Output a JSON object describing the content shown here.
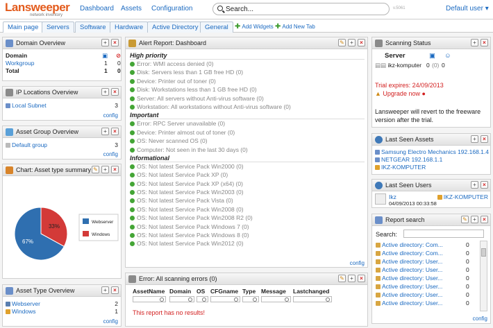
{
  "topbar": {
    "logo_main": "Lansweeper",
    "logo_sub": "network inventory",
    "nav": [
      "Dashboard",
      "Assets",
      "Configuration"
    ],
    "search_placeholder": "Search...",
    "version": "v.5061",
    "user_menu": "Default user ▾"
  },
  "tabs": [
    "Main page",
    "Servers",
    "Software",
    "Hardware",
    "Active Directory",
    "General"
  ],
  "tab_links": [
    "Add Widgets",
    "Add New Tab"
  ],
  "domain_overview": {
    "title": "Domain Overview",
    "header": "Domain",
    "rows": [
      {
        "name": "Workgroup",
        "a": "1",
        "b": "0"
      }
    ],
    "total": {
      "name": "Total",
      "a": "1",
      "b": "0"
    }
  },
  "ip_locations": {
    "title": "IP Locations Overview",
    "rows": [
      {
        "name": "Local Subnet",
        "count": "3"
      }
    ],
    "config": "config"
  },
  "asset_groups": {
    "title": "Asset Group Overview",
    "rows": [
      {
        "name": "Default group",
        "count": "3"
      }
    ],
    "config": "config"
  },
  "chart_widget": {
    "title": "Chart: Asset type summary"
  },
  "chart_data": {
    "type": "pie",
    "title": "",
    "categories": [
      "Webserver",
      "Windows"
    ],
    "values": [
      67,
      33
    ],
    "labels": [
      "67%",
      "33%"
    ],
    "colors": [
      "#2f6fb0",
      "#d33a38"
    ],
    "legend_position": "right"
  },
  "asset_types": {
    "title": "Asset Type Overview",
    "rows": [
      {
        "name": "Webserver",
        "count": "2"
      },
      {
        "name": "Windows",
        "count": "1"
      }
    ],
    "config": "config"
  },
  "alert_report": {
    "title": "Alert Report: Dashboard",
    "sections": [
      {
        "name": "High priority",
        "items": [
          "Error: WMI access denied (0)",
          "Disk: Servers less than 1 GB free HD (0)",
          "Device: Printer out of toner (0)",
          "Disk: Workstations less than 1 GB free HD (0)",
          "Server: All servers without Anti-virus software (0)",
          "Workstation: All workstations without Anti-virus software (0)"
        ]
      },
      {
        "name": "Important",
        "items": [
          "Error: RPC Server unavailable (0)",
          "Device: Printer almost out of toner (0)",
          "OS: Never scanned OS (0)",
          "Computer: Not seen in the last 30 days (0)"
        ]
      },
      {
        "name": "Informational",
        "items": [
          "OS: Not latest Service Pack Win2000 (0)",
          "OS: Not latest Service Pack XP (0)",
          "OS: Not latest Service Pack XP (x64) (0)",
          "OS: Not latest Service Pack Win2003 (0)",
          "OS: Not latest Service Pack Vista (0)",
          "OS: Not latest Service Pack Win2008 (0)",
          "OS: Not latest Service Pack Win2008 R2 (0)",
          "OS: Not latest Service Pack Windows 7 (0)",
          "OS: Not latest Service Pack Windows 8 (0)",
          "OS: Not latest Service Pack Win2012 (0)"
        ]
      }
    ],
    "config": "config"
  },
  "errors": {
    "title": "Error: All scanning errors (0)",
    "columns": [
      "AssetName",
      "Domain",
      "OS",
      "CFGname",
      "Type",
      "Message",
      "Lastchanged"
    ],
    "empty": "This report has no results!"
  },
  "scanning_status": {
    "title": "Scanning Status",
    "col": "Server",
    "server": "ikz-komputer",
    "c1": "0",
    "c2": "(0)",
    "c3": "0",
    "trial": "Trial expires: 24/09/2013",
    "upgrade": "Upgrade now",
    "note": "Lansweeper will revert to the freeware version after the trial."
  },
  "last_seen_assets": {
    "title": "Last Seen Assets",
    "rows": [
      "Samsung Electro Mechanics 192.168.1.4",
      "NETGEAR 192.168.1.1",
      "IKZ-KOMPUTER"
    ]
  },
  "last_seen_users": {
    "title": "Last Seen Users",
    "user": "Ikz",
    "computer": "IKZ-KOMPUTER",
    "time": "04/09/2013 00:33:58"
  },
  "report_search": {
    "title": "Report search",
    "label": "Search:",
    "rows": [
      {
        "name": "Active directory: Com...",
        "v": "0"
      },
      {
        "name": "Active directory: Com...",
        "v": "0"
      },
      {
        "name": "Active directory: User...",
        "v": "0"
      },
      {
        "name": "Active directory: User...",
        "v": "0"
      },
      {
        "name": "Active directory: User...",
        "v": "0"
      },
      {
        "name": "Active directory: User...",
        "v": "0"
      },
      {
        "name": "Active directory: User...",
        "v": "0"
      },
      {
        "name": "Active directory: User...",
        "v": "0"
      }
    ],
    "config": "config"
  }
}
